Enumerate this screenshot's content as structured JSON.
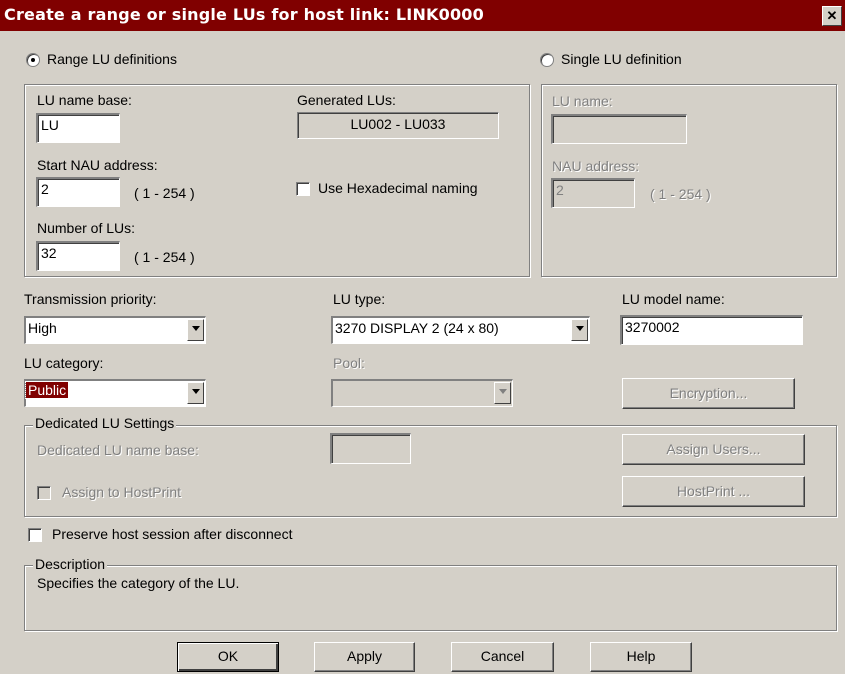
{
  "window": {
    "title": "Create a range or single LUs for host link: LINK0000",
    "close_glyph": "✕"
  },
  "range": {
    "radio_label": "Range LU definitions",
    "lu_name_base_label": "LU name base:",
    "lu_name_base_value": "LU",
    "generated_label": "Generated LUs:",
    "generated_value": "LU002 - LU033",
    "start_nau_label": "Start NAU address:",
    "start_nau_value": "2",
    "start_nau_range": "( 1 - 254 )",
    "hex_naming_label": "Use Hexadecimal naming",
    "num_lus_label": "Number of LUs:",
    "num_lus_value": "32",
    "num_lus_range": "( 1 - 254 )"
  },
  "single": {
    "radio_label": "Single LU definition",
    "lu_name_label": "LU name:",
    "lu_name_value": "",
    "nau_label": "NAU address:",
    "nau_value": "2",
    "nau_range": "( 1 - 254 )"
  },
  "settings": {
    "transmission_label": "Transmission priority:",
    "transmission_value": "High",
    "lu_type_label": "LU type:",
    "lu_type_value": "3270 DISPLAY 2 (24 x 80)",
    "lu_model_label": "LU model name:",
    "lu_model_value": "3270002",
    "lu_category_label": "LU category:",
    "lu_category_value": "Public",
    "pool_label": "Pool:",
    "pool_value": "",
    "encryption_button": "Encryption..."
  },
  "dedicated": {
    "legend": "Dedicated LU Settings",
    "name_base_label": "Dedicated LU name base:",
    "name_base_value": "",
    "assign_users_button": "Assign Users...",
    "assign_hostprint_label": "Assign to HostPrint",
    "hostprint_button": "HostPrint ..."
  },
  "preserve_label": "Preserve host session after disconnect",
  "description": {
    "legend": "Description",
    "text": "Specifies the category of the LU."
  },
  "buttons": {
    "ok": "OK",
    "apply": "Apply",
    "cancel": "Cancel",
    "help": "Help"
  },
  "colors": {
    "title_bar": "#800000",
    "face": "#d4d0c8",
    "selection": "#800000"
  }
}
